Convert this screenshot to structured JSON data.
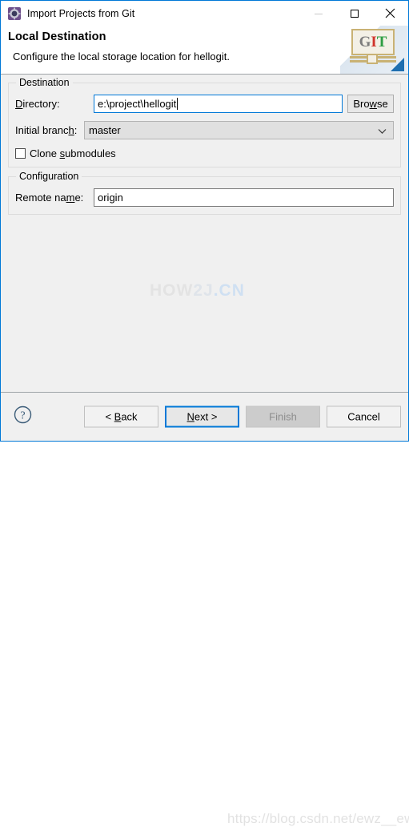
{
  "window": {
    "title": "Import Projects from Git",
    "icon": "eclipse-wizard-icon",
    "controls": {
      "minimize": "minimize-icon",
      "maximize": "maximize-icon",
      "close": "close-icon"
    }
  },
  "header": {
    "title": "Local Destination",
    "subtitle": "Configure the local storage location for hellogit.",
    "badge": {
      "g": "G",
      "i": "I",
      "t": "T"
    }
  },
  "destination": {
    "legend": "Destination",
    "directory": {
      "label_pre": "D",
      "label_accel": "",
      "label": "Directory:",
      "value": "e:\\project\\hellogit",
      "placeholder": "",
      "browse_label": "Browse"
    },
    "branch": {
      "label": "Initial branch:",
      "value": "master",
      "chevron": "chevron-down-icon"
    },
    "clone_submodules": {
      "label": "Clone submodules",
      "checked": false
    }
  },
  "configuration": {
    "legend": "Configuration",
    "remote": {
      "label": "Remote name:",
      "value": "origin",
      "placeholder": ""
    }
  },
  "watermarks": {
    "how2j": {
      "part1": "HOW",
      "part2": "2J",
      "part3": ".CN"
    },
    "csdn": "https://blog.csdn.net/ewz__ewz"
  },
  "footer": {
    "help": "help-icon",
    "back_label": "< Back",
    "next_label": "Next >",
    "finish_label": "Finish",
    "cancel_label": "Cancel"
  },
  "colors": {
    "accent": "#0078d7",
    "dialog_bg": "#f0f0f0",
    "git_g": "#7d7d7d",
    "git_i": "#d0342c",
    "git_t": "#2f9e44"
  }
}
